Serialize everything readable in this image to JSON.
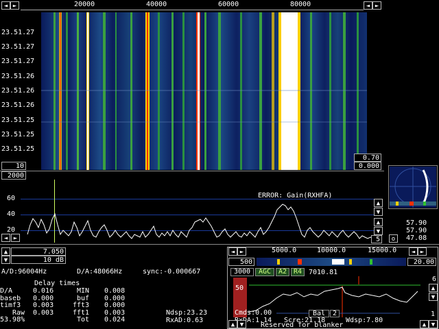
{
  "waterfall": {
    "freq_ticks": [
      "20000",
      "40000",
      "60000",
      "80000"
    ],
    "time_labels": [
      "23.51.27",
      "23.51.27",
      "23.51.27",
      "23.51.26",
      "23.51.26",
      "23.51.26",
      "23.51.25",
      "23.51.25",
      "23.51.25"
    ],
    "left_box": "10",
    "right_box_top": "0.70",
    "right_box_bottom": "0.000"
  },
  "spectrum": {
    "top_box": "2000",
    "y_ticks": [
      "60",
      "40",
      "20"
    ],
    "error_text": "ERROR: Gain(RXHFA)",
    "right_box": "5"
  },
  "sidepanel": {
    "values": [
      "57.90",
      "57.90",
      "47.08"
    ],
    "o_label": "o"
  },
  "controls": {
    "freq_value": "7.050",
    "gain_value": "10 dB"
  },
  "status": {
    "ad_rate": "A/D:96004Hz",
    "da_rate": "D/A:48066Hz",
    "sync": "sync:-0.000667",
    "delay_title": "Delay times",
    "rows": [
      [
        "D/A",
        "0.016",
        "MIN",
        "0.008"
      ],
      [
        "baseb",
        "0.000",
        "buf",
        "0.000"
      ],
      [
        "timf3",
        "0.003",
        "fft3",
        "0.000"
      ],
      [
        "Raw",
        "0.003",
        "fft1",
        "0.003"
      ],
      [
        "53.98%",
        "",
        "Tot",
        "0.024"
      ]
    ],
    "ndsp": "Ndsp:23.23",
    "cmds": "Cmds:0.00",
    "rxad": "RxAD:0.63",
    "rxda": "RxDA:1.14",
    "scre": "Scre:21.18",
    "wdsp": "Wdsp:7.80",
    "reserved": "Reserved for blanker"
  },
  "baseband": {
    "freq_ticks": [
      "5000.0",
      "10000.0",
      "15000.0"
    ],
    "left_box": "500",
    "right_box": "20.00",
    "bw_box": "3000",
    "agc": "AGC",
    "a2": "A2",
    "r4": "R4",
    "freq_readout": "7010.81",
    "level_value": "50",
    "right_scale_top": "6",
    "right_scale_bottom": "1",
    "bottom_buttons": [
      "Bal",
      "2"
    ]
  },
  "colors": {
    "background": "#000000",
    "grid_blue": "#1a3a9a",
    "waterfall_low": "#0a1a5a",
    "signal_yellow": "#ffd000",
    "signal_red": "#ff2000",
    "agc_green": "#30c030",
    "level_red": "#a02020"
  }
}
